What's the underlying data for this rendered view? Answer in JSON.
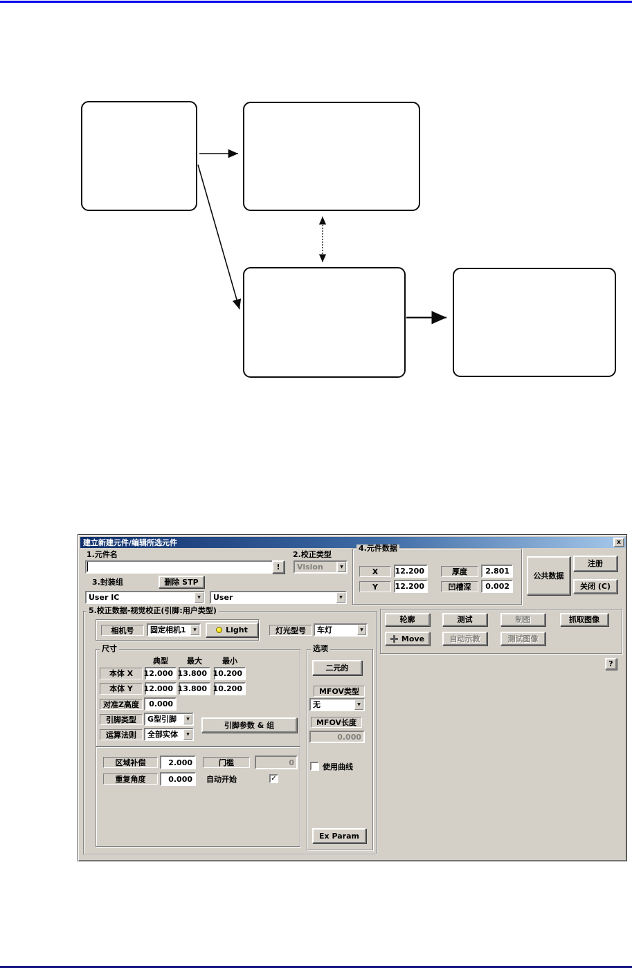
{
  "colors": {
    "top_rule": "#0000ee",
    "bottom_rule": "#1b1b86",
    "dialog_bg": "#d4d0c8",
    "titlebar_left": "#0f2f6d",
    "titlebar_right": "#a6c8ea",
    "disabled_text": "#84827c"
  },
  "icons": {
    "dropdown_arrow": "▼",
    "check": "✓"
  },
  "flowchart": {
    "boxes": [
      {
        "id": 1,
        "text": ""
      },
      {
        "id": 2,
        "text": ""
      },
      {
        "id": 3,
        "text": ""
      },
      {
        "id": 4,
        "text": ""
      }
    ],
    "arrows": [
      {
        "from": 1,
        "to": 2,
        "style": "solid"
      },
      {
        "from": 1,
        "to": 3,
        "style": "solid"
      },
      {
        "from": 2,
        "to": 3,
        "style": "dotted",
        "bidirectional": true
      },
      {
        "from": 3,
        "to": 4,
        "style": "solid-bold"
      }
    ]
  },
  "window": {
    "title": "建立新建元件/编辑所选元件",
    "close_glyph": "x"
  },
  "s1": {
    "label": "1.元件名",
    "value": "",
    "warn_button": "!"
  },
  "s2": {
    "label": "2.校正类型",
    "value": "Vision"
  },
  "s3": {
    "label": "3.封装组",
    "delete_button": "删除 STP",
    "pkg_group1": "User IC",
    "pkg_group2": "User"
  },
  "s4": {
    "label": "4.元件数据",
    "x": {
      "label": "X",
      "value": "12.200"
    },
    "y": {
      "label": "Y",
      "value": "12.200"
    },
    "thickness": {
      "label": "厚度",
      "value": "2.801"
    },
    "groove": {
      "label": "凹槽深",
      "value": "0.002"
    }
  },
  "side": {
    "common_data_button": "公共数据",
    "register_button": "注册",
    "close_button": "关闭 (C)"
  },
  "s5": {
    "label": "5.校正数据-视觉校正(引脚:用户类型)",
    "camera": {
      "label": "相机号",
      "value": "固定相机1"
    },
    "light_button": "Light",
    "lamp": {
      "label": "灯光型号",
      "value": "车灯"
    },
    "size": {
      "label": "尺寸",
      "headers": {
        "typ": "典型",
        "max": "最大",
        "min": "最小"
      },
      "rows": [
        {
          "label": "本体 X",
          "typ": "12.000",
          "max": "13.800",
          "min": "10.200"
        },
        {
          "label": "本体 Y",
          "typ": "12.000",
          "max": "13.800",
          "min": "10.200"
        }
      ],
      "align_z": {
        "label": "对准Z高度",
        "value": "0.000"
      },
      "lead_type": {
        "label": "引脚类型",
        "value": "G型引脚"
      },
      "algorithm": {
        "label": "运算法则",
        "value": "全部实体"
      },
      "lead_param_button": "引脚参数 & 组"
    },
    "comp": {
      "area": {
        "label": "区域补偿",
        "value": "2.000"
      },
      "threshold": {
        "label": "门槛",
        "value": "0"
      },
      "repeat_angle": {
        "label": "重复角度",
        "value": "0.000"
      },
      "auto_start": {
        "label": "自动开始",
        "checked": true
      }
    },
    "opts": {
      "label": "选项",
      "binary_button": "二元的",
      "mfov_type": {
        "label": "MFOV类型",
        "value": "无"
      },
      "mfov_len": {
        "label": "MFOV长度",
        "value": "0.000"
      },
      "use_curve": {
        "label": "使用曲线",
        "checked": false
      },
      "ex_param_button": "Ex Param"
    },
    "actions": {
      "r1": [
        {
          "label": "轮廓",
          "enabled": true
        },
        {
          "label": "测试",
          "enabled": true
        },
        {
          "label": "制图",
          "enabled": false
        },
        {
          "label": "抓取图像",
          "enabled": true
        }
      ],
      "r2": [
        {
          "label": "Move",
          "enabled": true
        },
        {
          "label": "自动示教",
          "enabled": false
        },
        {
          "label": "测试图像",
          "enabled": false
        }
      ]
    },
    "help_button": "?"
  }
}
